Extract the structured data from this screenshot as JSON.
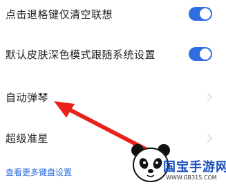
{
  "settings": {
    "items": [
      {
        "label": "点击退格键仅清空联想",
        "control": "toggle",
        "on": true
      },
      {
        "label": "默认皮肤深色模式跟随系统设置",
        "control": "toggle",
        "on": true
      },
      {
        "label": "自动弹琴",
        "control": "chevron"
      },
      {
        "label": "超级准星",
        "control": "chevron"
      }
    ],
    "more_link": "查看更多键盘设置"
  },
  "colors": {
    "accent": "#2f6de0",
    "annotation_arrow": "#e8221b"
  },
  "icons": [
    "chevron-right-icon",
    "toggle-switch",
    "red-arrow-annotation",
    "panda-logo"
  ],
  "watermark": {
    "brand": "国宝手游网",
    "url": "WWW.GB315.COM"
  }
}
